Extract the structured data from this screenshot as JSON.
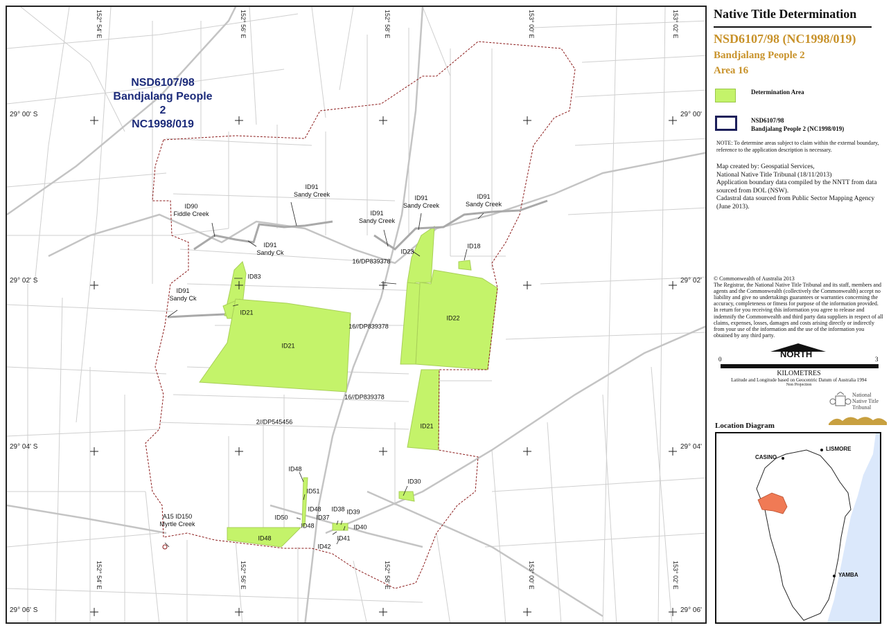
{
  "map": {
    "title_id": "NSD6107/98",
    "title_name": "Bandjalang People 2",
    "title_ref": "NC1998/019",
    "lat_labels": [
      "29° 00' S",
      "29° 02' S",
      "29° 04' S",
      "29° 06' S"
    ],
    "lat_labels_right": [
      "29° 00'",
      "29° 02'",
      "29° 04'",
      "29° 06'"
    ],
    "lon_labels": [
      "152° 54' E",
      "152° 56' E",
      "152° 58' E",
      "153° 00' E",
      "153° 02' E"
    ],
    "features": {
      "id90": "ID90",
      "fiddle_creek": "Fiddle Creek",
      "id91": "ID91",
      "sandy_creek": "Sandy Creek",
      "sandy_ck": "Sandy Ck",
      "id83": "ID83",
      "id21": "ID21",
      "id22": "ID22",
      "id23": "ID23",
      "id18": "ID18",
      "id30": "ID30",
      "id48": "ID48",
      "id51": "ID51",
      "id50": "ID50",
      "id37": "ID37",
      "id38": "ID38",
      "id39": "ID39",
      "id40": "ID40",
      "id41": "ID41",
      "id42": "ID42",
      "a15_id150": "A15 ID150",
      "myrtle_creek": "Myrtle Creek",
      "lot_16_dp839378": "16//DP839378",
      "lot_16_dp839378_b": "16/DP839378",
      "lot_2_dp545456": "2//DP545456"
    }
  },
  "panel": {
    "heading": "Native Title Determination",
    "determination_id": "NSD6107/98 (NC1998/019)",
    "determination_name": "Bandjalang People 2",
    "area": "Area 16",
    "legend": {
      "determination_area": "Determination Area",
      "boundary_line1": "NSD6107/98",
      "boundary_line2": "Bandjalang People 2 (NC1998/019)"
    },
    "note": "NOTE: To determine areas subject to claim within the external boundary, reference to the application description is necessary.",
    "credits": [
      "Map created by: Geospatial Services,",
      "National Native Title Tribunal   (18/11/2013)",
      "Application boundary data compiled by the NNTT from data sourced from DOL (NSW).",
      "Cadastral data sourced from Public Sector Mapping Agency (June 2013)."
    ],
    "copyright_line": "© Commonwealth of Australia 2013",
    "disclaimer": "The Registrar, the National Native Title Tribunal and its staff, members and agents and the Commonwealth (collectively the Commonwealth) accept no liability and give no undertakings guarantees or warranties concerning the accuracy, completeness or fitness for purpose of the information provided. In return for you receiving this information you agree to release and indemnify the Commonwealth and third party data suppliers in respect of all claims, expenses, losses, damages and costs arising directly or indirectly from your use of the information and the use of the information you obtained by any third party.",
    "north": "NORTH",
    "scale_start": "0",
    "scale_end": "3",
    "scale_unit": "KILOMETRES",
    "datum": "Latitude and Longitude based on Geocentric Datum of Australia 1994",
    "projection": "Non Projection",
    "logo_text": [
      "National",
      "Native Title",
      "Tribunal"
    ],
    "location_title": "Location Diagram",
    "towns": [
      "CASINO",
      "LISMORE",
      "YAMBA"
    ]
  },
  "colors": {
    "determination_fill": "#c4f36a",
    "boundary": "#8b1a1a",
    "title_text": "#1c2b7a",
    "accent": "#c8922a",
    "sea": "#dbe8fb",
    "location_highlight": "#f07a55"
  }
}
